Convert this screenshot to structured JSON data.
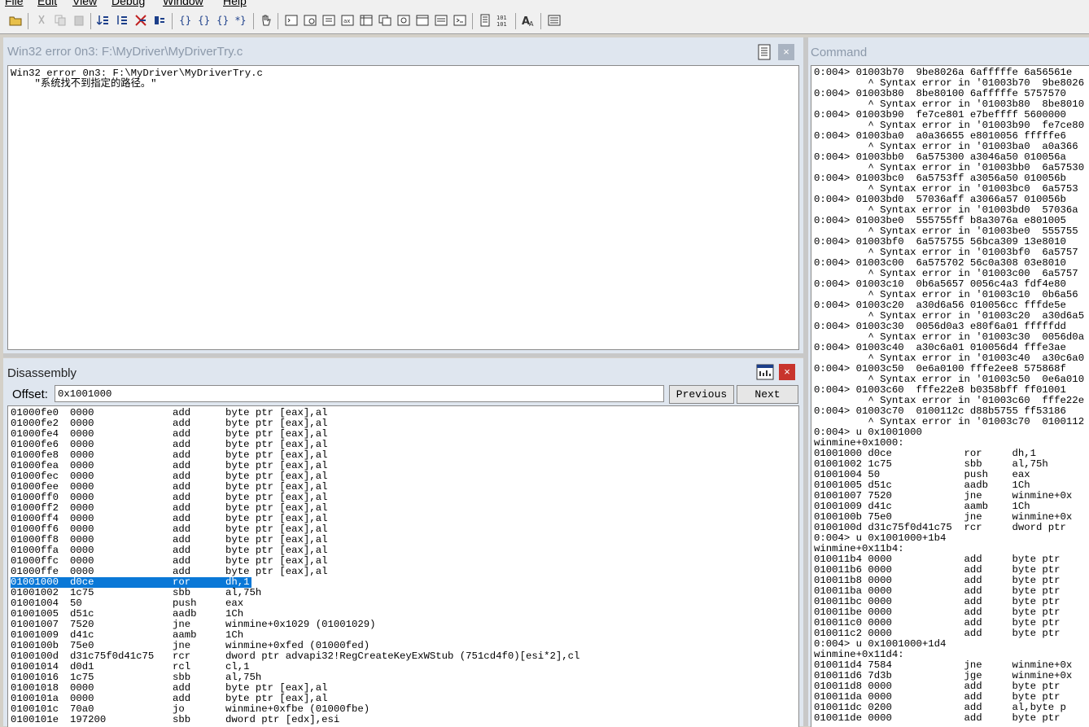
{
  "menu": [
    "File",
    "Edit",
    "View",
    "Debug",
    "Window",
    "Help"
  ],
  "source_pane": {
    "title": "Win32 error 0n3: F:\\MyDriver\\MyDriverTry.c",
    "close": "×",
    "lines": [
      "Win32 error 0n3: F:\\MyDriver\\MyDriverTry.c",
      "    \"系统找不到指定的路径。\""
    ]
  },
  "disassembly": {
    "title": "Disassembly",
    "close": "×",
    "offset_label": "Offset:",
    "offset_value": "0x1001000",
    "previous_label": "Previous",
    "next_label": "Next",
    "rows": [
      {
        "addr": "01000fe0",
        "bytes": "0000",
        "op": "add",
        "args": "byte ptr [eax],al"
      },
      {
        "addr": "01000fe2",
        "bytes": "0000",
        "op": "add",
        "args": "byte ptr [eax],al"
      },
      {
        "addr": "01000fe4",
        "bytes": "0000",
        "op": "add",
        "args": "byte ptr [eax],al"
      },
      {
        "addr": "01000fe6",
        "bytes": "0000",
        "op": "add",
        "args": "byte ptr [eax],al"
      },
      {
        "addr": "01000fe8",
        "bytes": "0000",
        "op": "add",
        "args": "byte ptr [eax],al"
      },
      {
        "addr": "01000fea",
        "bytes": "0000",
        "op": "add",
        "args": "byte ptr [eax],al"
      },
      {
        "addr": "01000fec",
        "bytes": "0000",
        "op": "add",
        "args": "byte ptr [eax],al"
      },
      {
        "addr": "01000fee",
        "bytes": "0000",
        "op": "add",
        "args": "byte ptr [eax],al"
      },
      {
        "addr": "01000ff0",
        "bytes": "0000",
        "op": "add",
        "args": "byte ptr [eax],al"
      },
      {
        "addr": "01000ff2",
        "bytes": "0000",
        "op": "add",
        "args": "byte ptr [eax],al"
      },
      {
        "addr": "01000ff4",
        "bytes": "0000",
        "op": "add",
        "args": "byte ptr [eax],al"
      },
      {
        "addr": "01000ff6",
        "bytes": "0000",
        "op": "add",
        "args": "byte ptr [eax],al"
      },
      {
        "addr": "01000ff8",
        "bytes": "0000",
        "op": "add",
        "args": "byte ptr [eax],al"
      },
      {
        "addr": "01000ffa",
        "bytes": "0000",
        "op": "add",
        "args": "byte ptr [eax],al"
      },
      {
        "addr": "01000ffc",
        "bytes": "0000",
        "op": "add",
        "args": "byte ptr [eax],al"
      },
      {
        "addr": "01000ffe",
        "bytes": "0000",
        "op": "add",
        "args": "byte ptr [eax],al"
      },
      {
        "addr": "01001000",
        "bytes": "d0ce",
        "op": "ror",
        "args": "dh,1",
        "selected": true
      },
      {
        "addr": "01001002",
        "bytes": "1c75",
        "op": "sbb",
        "args": "al,75h"
      },
      {
        "addr": "01001004",
        "bytes": "50",
        "op": "push",
        "args": "eax"
      },
      {
        "addr": "01001005",
        "bytes": "d51c",
        "op": "aadb",
        "args": "1Ch"
      },
      {
        "addr": "01001007",
        "bytes": "7520",
        "op": "jne",
        "args": "winmine+0x1029 (01001029)"
      },
      {
        "addr": "01001009",
        "bytes": "d41c",
        "op": "aamb",
        "args": "1Ch"
      },
      {
        "addr": "0100100b",
        "bytes": "75e0",
        "op": "jne",
        "args": "winmine+0xfed (01000fed)"
      },
      {
        "addr": "0100100d",
        "bytes": "d31c75f0d41c75",
        "op": "rcr",
        "args": "dword ptr advapi32!RegCreateKeyExWStub (751cd4f0)[esi*2],cl"
      },
      {
        "addr": "01001014",
        "bytes": "d0d1",
        "op": "rcl",
        "args": "cl,1"
      },
      {
        "addr": "01001016",
        "bytes": "1c75",
        "op": "sbb",
        "args": "al,75h"
      },
      {
        "addr": "01001018",
        "bytes": "0000",
        "op": "add",
        "args": "byte ptr [eax],al"
      },
      {
        "addr": "0100101a",
        "bytes": "0000",
        "op": "add",
        "args": "byte ptr [eax],al"
      },
      {
        "addr": "0100101c",
        "bytes": "70a0",
        "op": "jo",
        "args": "winmine+0xfbe (01000fbe)"
      },
      {
        "addr": "0100101e",
        "bytes": "197200",
        "op": "sbb",
        "args": "dword ptr [edx],esi"
      }
    ]
  },
  "command": {
    "title": "Command",
    "lines": [
      "0:004> 01003b70  9be8026a 6afffffe 6a56561e",
      "         ^ Syntax error in '01003b70  9be8026",
      "0:004> 01003b80  8be80100 6afffffe 5757570",
      "         ^ Syntax error in '01003b80  8be8010",
      "0:004> 01003b90  fe7ce801 e7beffff 5600000",
      "         ^ Syntax error in '01003b90  fe7ce80",
      "0:004> 01003ba0  a0a36655 e8010056 fffffe6",
      "         ^ Syntax error in '01003ba0  a0a366",
      "0:004> 01003bb0  6a575300 a3046a50 010056a",
      "         ^ Syntax error in '01003bb0  6a57530",
      "0:004> 01003bc0  6a5753ff a3056a50 010056b",
      "         ^ Syntax error in '01003bc0  6a5753",
      "0:004> 01003bd0  57036aff a3066a57 010056b",
      "         ^ Syntax error in '01003bd0  57036a",
      "0:004> 01003be0  555755ff b8a3076a e801005",
      "         ^ Syntax error in '01003be0  555755",
      "0:004> 01003bf0  6a575755 56bca309 13e8010",
      "         ^ Syntax error in '01003bf0  6a5757",
      "0:004> 01003c00  6a575702 56c0a308 03e8010",
      "         ^ Syntax error in '01003c00  6a5757",
      "0:004> 01003c10  0b6a5657 0056c4a3 fdf4e80",
      "         ^ Syntax error in '01003c10  0b6a56",
      "0:004> 01003c20  a30d6a56 010056cc fffde5e",
      "         ^ Syntax error in '01003c20  a30d6a5",
      "0:004> 01003c30  0056d0a3 e80f6a01 fffffdd",
      "         ^ Syntax error in '01003c30  0056d0a",
      "0:004> 01003c40  a30c6a01 010056d4 fffe3ae",
      "         ^ Syntax error in '01003c40  a30c6a0",
      "0:004> 01003c50  0e6a0100 fffe2ee8 575868f",
      "         ^ Syntax error in '01003c50  0e6a010",
      "0:004> 01003c60  fffe22e8 b0358bff ff01001",
      "         ^ Syntax error in '01003c60  fffe22e",
      "0:004> 01003c70  0100112c d88b5755 ff53186",
      "         ^ Syntax error in '01003c70  0100112",
      "0:004> u 0x1001000",
      "winmine+0x1000:",
      "01001000 d0ce            ror     dh,1",
      "01001002 1c75            sbb     al,75h",
      "01001004 50              push    eax",
      "01001005 d51c            aadb    1Ch",
      "01001007 7520            jne     winmine+0x",
      "01001009 d41c            aamb    1Ch",
      "0100100b 75e0            jne     winmine+0x",
      "0100100d d31c75f0d41c75  rcr     dword ptr",
      "0:004> u 0x1001000+1b4",
      "winmine+0x11b4:",
      "010011b4 0000            add     byte ptr",
      "010011b6 0000            add     byte ptr",
      "010011b8 0000            add     byte ptr",
      "010011ba 0000            add     byte ptr",
      "010011bc 0000            add     byte ptr",
      "010011be 0000            add     byte ptr",
      "010011c0 0000            add     byte ptr",
      "010011c2 0000            add     byte ptr",
      "0:004> u 0x1001000+1d4",
      "winmine+0x11d4:",
      "010011d4 7584            jne     winmine+0x",
      "010011d6 7d3b            jge     winmine+0x",
      "010011d8 0000            add     byte ptr",
      "010011da 0000            add     byte ptr",
      "010011dc 0200            add     al,byte p",
      "010011de 0000            add     byte ptr"
    ]
  },
  "colors": {
    "selection": "#0a78d7",
    "close_active": "#c8342d",
    "close_inactive": "#a9b3c1"
  }
}
